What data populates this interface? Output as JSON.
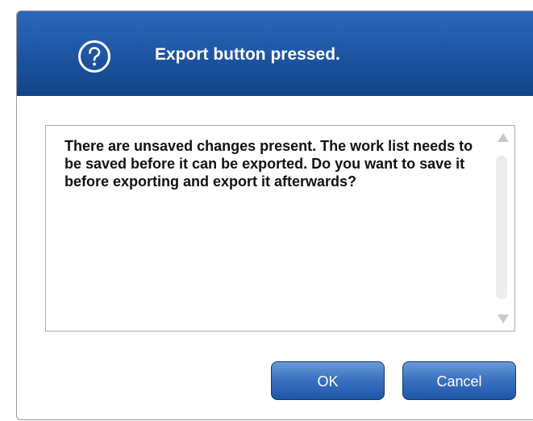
{
  "dialog": {
    "title": "Export button pressed.",
    "icon": "question-circle-icon",
    "message": "There are unsaved changes present. The work list needs to be saved before it can be exported. Do you want to save it before exporting and export it afterwards?",
    "buttons": {
      "ok_label": "OK",
      "cancel_label": "Cancel"
    }
  },
  "colors": {
    "titlebar": "#1f58a6",
    "button": "#3d72c2"
  }
}
